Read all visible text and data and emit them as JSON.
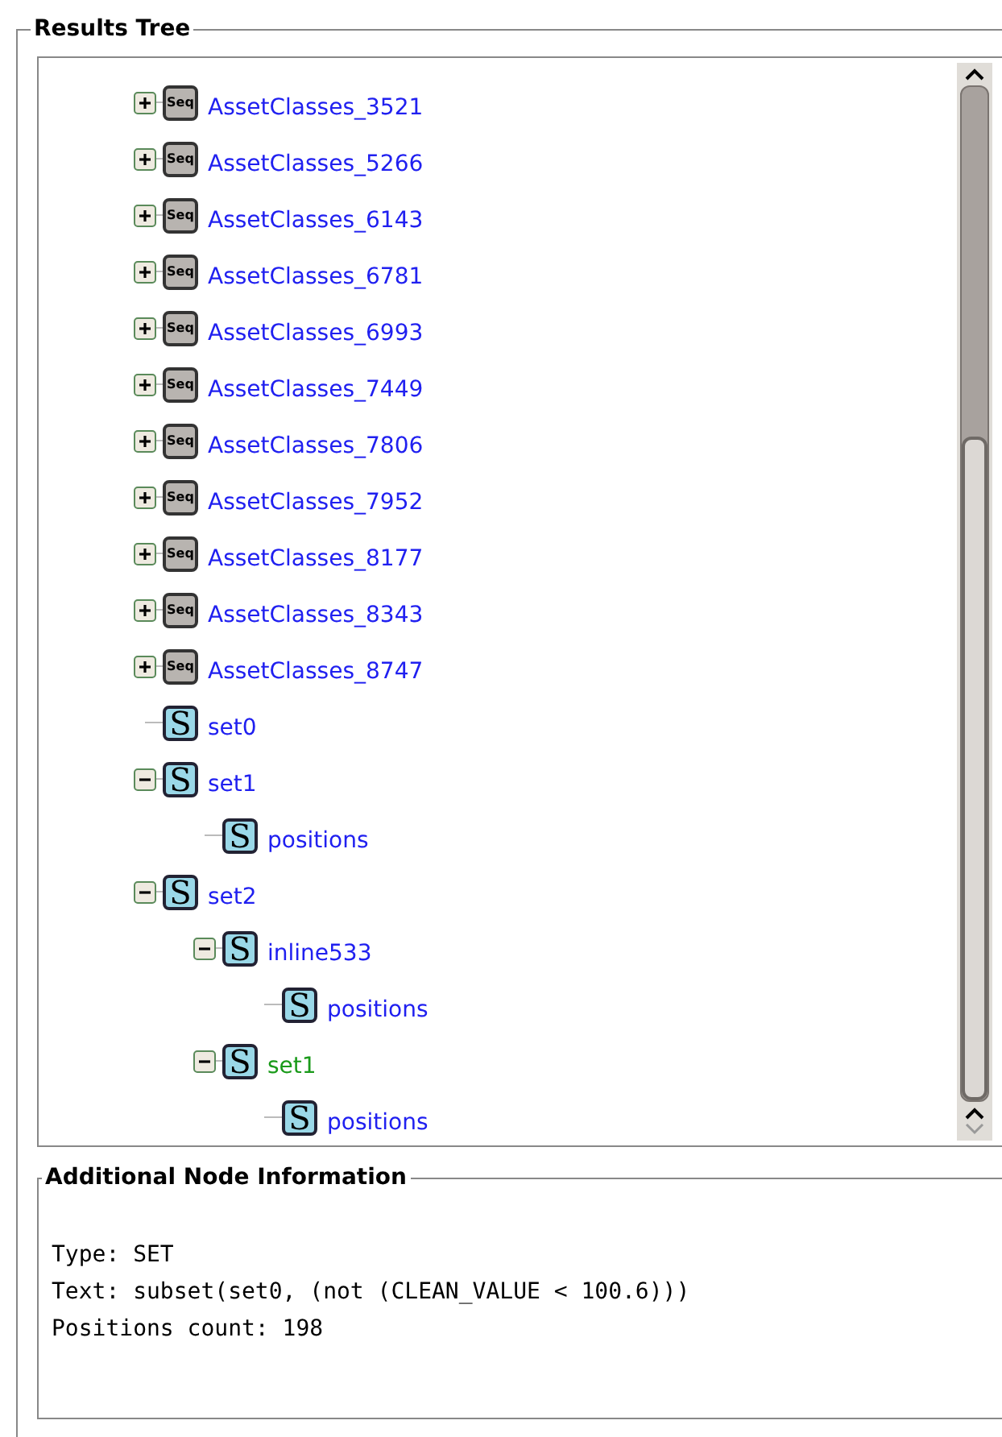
{
  "results_tree": {
    "title": "Results Tree",
    "nodes": [
      {
        "kind": "seq",
        "icon_text": "Seq",
        "label": "AssetClasses_3521",
        "color": "#2020f0",
        "expanded": false
      },
      {
        "kind": "seq",
        "icon_text": "Seq",
        "label": "AssetClasses_5266",
        "color": "#2020f0",
        "expanded": false
      },
      {
        "kind": "seq",
        "icon_text": "Seq",
        "label": "AssetClasses_6143",
        "color": "#2020f0",
        "expanded": false
      },
      {
        "kind": "seq",
        "icon_text": "Seq",
        "label": "AssetClasses_6781",
        "color": "#2020f0",
        "expanded": false
      },
      {
        "kind": "seq",
        "icon_text": "Seq",
        "label": "AssetClasses_6993",
        "color": "#2020f0",
        "expanded": false
      },
      {
        "kind": "seq",
        "icon_text": "Seq",
        "label": "AssetClasses_7449",
        "color": "#2020f0",
        "expanded": false
      },
      {
        "kind": "seq",
        "icon_text": "Seq",
        "label": "AssetClasses_7806",
        "color": "#2020f0",
        "expanded": false
      },
      {
        "kind": "seq",
        "icon_text": "Seq",
        "label": "AssetClasses_7952",
        "color": "#2020f0",
        "expanded": false
      },
      {
        "kind": "seq",
        "icon_text": "Seq",
        "label": "AssetClasses_8177",
        "color": "#2020f0",
        "expanded": false
      },
      {
        "kind": "seq",
        "icon_text": "Seq",
        "label": "AssetClasses_8343",
        "color": "#2020f0",
        "expanded": false
      },
      {
        "kind": "seq",
        "icon_text": "Seq",
        "label": "AssetClasses_8747",
        "color": "#2020f0",
        "expanded": false
      },
      {
        "kind": "set",
        "icon_text": "S",
        "label": "set0",
        "color": "#2020f0"
      },
      {
        "kind": "set",
        "icon_text": "S",
        "label": "set1",
        "color": "#2020f0",
        "expanded": true,
        "children": [
          {
            "kind": "set",
            "icon_text": "S",
            "label": "positions",
            "color": "#2020f0"
          }
        ]
      },
      {
        "kind": "set",
        "icon_text": "S",
        "label": "set2",
        "color": "#2020f0",
        "expanded": true,
        "children": [
          {
            "kind": "set",
            "icon_text": "S",
            "label": "inline533",
            "color": "#2020f0",
            "expanded": true,
            "children": [
              {
                "kind": "set",
                "icon_text": "S",
                "label": "positions",
                "color": "#2020f0"
              }
            ]
          },
          {
            "kind": "set",
            "icon_text": "S",
            "label": "set1",
            "color": "#1a9a1a",
            "expanded": true,
            "children": [
              {
                "kind": "set",
                "icon_text": "S",
                "label": "positions",
                "color": "#2020f0"
              }
            ]
          }
        ]
      }
    ]
  },
  "node_info": {
    "title": "Additional Node Information",
    "lines": [
      "Type: SET",
      "Text: subset(set0, (not (CLEAN_VALUE < 100.6)))",
      "Positions count: 198"
    ]
  }
}
